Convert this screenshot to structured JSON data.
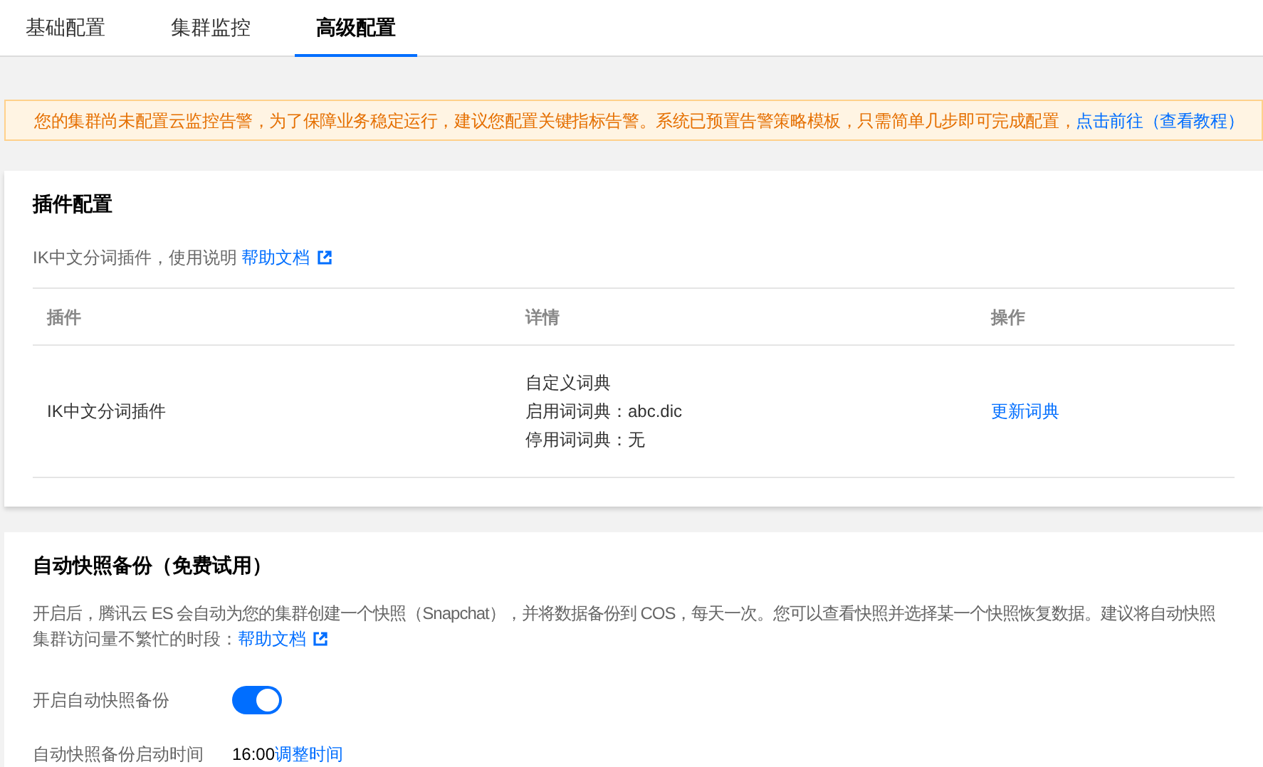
{
  "tabs": [
    {
      "label": "基础配置",
      "selected": false
    },
    {
      "label": "集群监控",
      "selected": false
    },
    {
      "label": "高级配置",
      "selected": true
    }
  ],
  "notice": {
    "text": "您的集群尚未配置云监控告警，为了保障业务稳定运行，建议您配置关键指标告警。系统已预置告警策略模板，只需简单几步即可完成配置，",
    "link": "点击前往",
    "link_2": "（查看教程）"
  },
  "plugin_card": {
    "title": "插件配置",
    "description": "IK中文分词插件，使用说明 ",
    "help_link": "帮助文档",
    "table": {
      "columns": [
        "插件",
        "详情",
        "操作"
      ],
      "rows": [
        {
          "plugin": "IK中文分词插件",
          "details": [
            "自定义词典",
            "启用词词典：abc.dic",
            "停用词词典：无"
          ],
          "action": "更新词典"
        }
      ]
    }
  },
  "snapshot_card": {
    "title": "自动快照备份（免费试用）",
    "description_line_1": "开启后，腾讯云 ES 会自动为您的集群创建一个快照（Snapchat），并将数据备份到 COS，每天一次。您可以查看快照并选择某一个快照恢复数据。建议将自动快照",
    "description_line_2": "集群访问量不繁忙的时段：",
    "help_link": "帮助文档",
    "toggle": {
      "label": "开启自动快照备份",
      "on": true
    },
    "start_time": {
      "label": "自动快照备份启动时间",
      "value": "16:00",
      "link": "调整时间"
    }
  }
}
